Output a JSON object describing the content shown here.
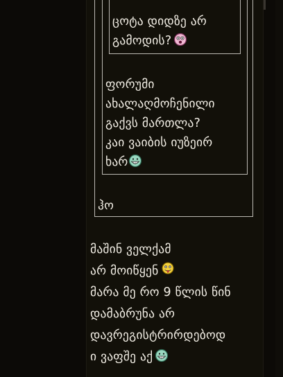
{
  "inner_quote": {
    "lines": [
      "ცოტა დიდზე არ",
      "გამოდის?"
    ]
  },
  "middle_quote": {
    "lines": [
      "ფორუმი",
      "ახალაღმოჩენილი",
      "გაქვს მართლა?",
      "კაი ვაიბის იუზეირ",
      "ხარ"
    ]
  },
  "outer_quote": {
    "text": "ჰო"
  },
  "reply": {
    "lines": [
      "მაშინ ველქამ",
      "არ მოიწყენ",
      "მარა მე რო 9 წლის წინ",
      "დამაბრუნა არ",
      "დავრეგისტრირდებოდ",
      "ი ვაფშე აქ"
    ]
  },
  "icons": {
    "inner_emoji": "astonished-emoji-icon",
    "middle_emoji": "grin-emoji-icon",
    "reply_emoji_1": "tongue-out-emoji-icon",
    "reply_emoji_2": "grin-emoji-icon"
  },
  "colors": {
    "background": "#0c0a07",
    "text": "#f3efe6",
    "border": "#bdbab4"
  }
}
